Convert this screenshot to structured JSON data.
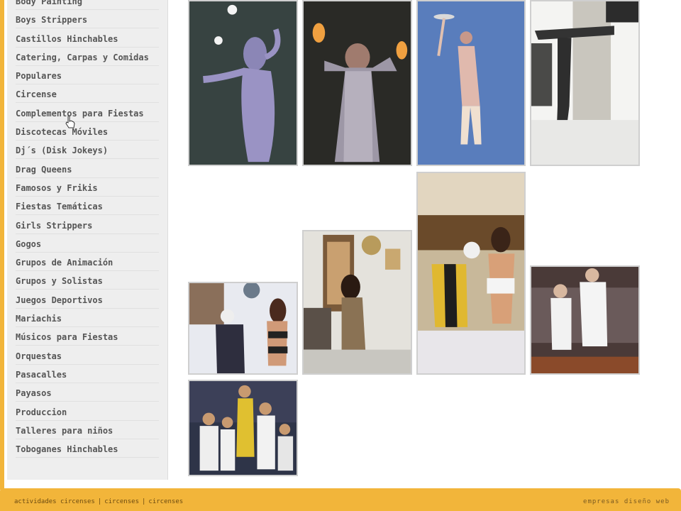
{
  "sidebar": {
    "items": [
      "Body Painting",
      "Boys Strippers",
      "Castillos Hinchables",
      "Catering, Carpas y Comidas",
      "Populares",
      "Circense",
      "Complementos para Fiestas",
      "Discotecas Móviles",
      "Dj´s (Disk Jokeys)",
      "Drag Queens",
      "Famosos y Frikis",
      "Fiestas Temáticas",
      "Girls Strippers",
      "Gogos",
      "Grupos de Animación",
      "Grupos y Solistas",
      "Juegos Deportivos",
      "Mariachis",
      "Músicos para Fiestas",
      "Orquestas",
      "Pasacalles",
      "Payasos",
      "Produccion",
      "Talleres para niños",
      "Toboganes Hinchables"
    ]
  },
  "footer": {
    "link1": "actividades circenses",
    "link2": "circenses",
    "link3": "circenses",
    "separator": "|",
    "right_text": "empresas diseño web"
  },
  "colors": {
    "accent": "#f2b53a",
    "sidebar_bg": "#eeeeee",
    "link_text": "#555555"
  }
}
